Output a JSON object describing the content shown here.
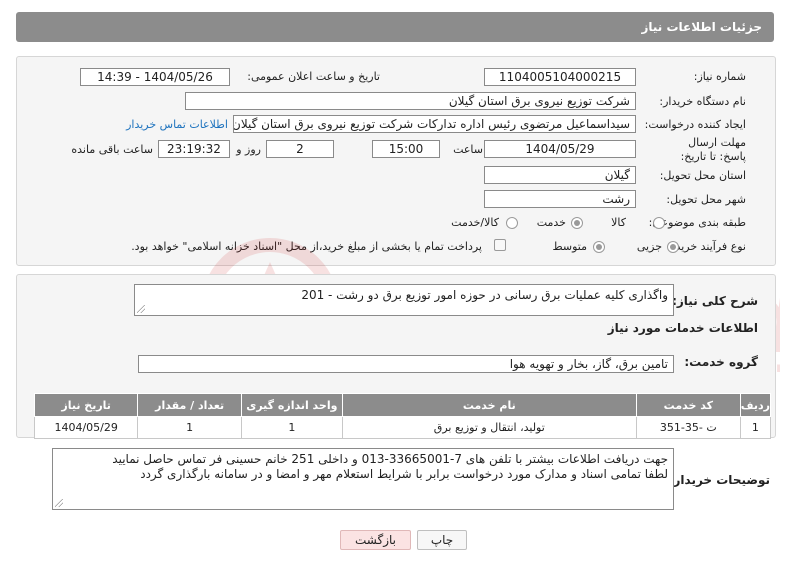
{
  "header": {
    "title": "جزئیات اطلاعات نیاز"
  },
  "form": {
    "need_number": {
      "label": "شماره نیاز:",
      "value": "1104005104000215"
    },
    "announce": {
      "label": "تاریخ و ساعت اعلان عمومی:",
      "value": "1404/05/26 - 14:39"
    },
    "buyer": {
      "label": "نام دستگاه خریدار:",
      "value": "شرکت توزیع نیروی برق استان گیلان"
    },
    "creator": {
      "label": "ایجاد کننده درخواست:",
      "value": "سیداسماعیل مرتضوی رئیس اداره تدارکات شرکت توزیع نیروی برق استان گیلان",
      "contact_link": "اطلاعات تماس خریدار"
    },
    "deadline": {
      "label": "مهلت ارسال پاسخ: تا تاریخ:",
      "date": "1404/05/29",
      "time_label": "ساعت",
      "time": "15:00",
      "days": "2",
      "days_label": "روز و",
      "remaining": "23:19:32",
      "remaining_label": "ساعت باقی مانده"
    },
    "province": {
      "label": "استان محل تحویل:",
      "value": "گیلان"
    },
    "city": {
      "label": "شهر محل تحویل:",
      "value": "رشت"
    },
    "category": {
      "label": "طبقه بندی موضوعی:",
      "options": [
        "کالا",
        "خدمت",
        "کالا/خدمت"
      ],
      "selected": "خدمت"
    },
    "process": {
      "label": "نوع فرآیند خرید :",
      "options": [
        "جزیی",
        "متوسط"
      ],
      "selected": "جزیی",
      "note": "پرداخت تمام یا بخشی از مبلغ خرید،از محل \"اسناد خزانه اسلامی\" خواهد بود."
    }
  },
  "summary": {
    "label": "شرح کلی نیاز:",
    "value": "واگذاری کلیه عملیات برق رسانی در حوزه امور توزیع برق دو رشت - 201"
  },
  "services": {
    "title": "اطلاعات خدمات مورد نیاز",
    "group_label": "گروه خدمت:",
    "group_value": "تامین برق، گاز، بخار و تهویه هوا",
    "columns": [
      "ردیف",
      "کد خدمت",
      "نام خدمت",
      "واحد اندازه گیری",
      "تعداد / مقدار",
      "تاریخ نیاز"
    ],
    "rows": [
      [
        "1",
        "ت -35-351",
        "تولید، انتقال و توزیع برق",
        "1",
        "1",
        "1404/05/29"
      ]
    ]
  },
  "notes": {
    "label": "توضیحات خریدار:",
    "line1": "جهت دریافت اطلاعات بیشتر با تلفن های 7-33665001-013 و داخلی 251 خانم حسینی فر تماس حاصل نمایید",
    "line2": "لطفا تمامی اسناد و مدارک مورد درخواست برابر با شرایط استعلام مهر و امضا و در سامانه بارگذاری گردد"
  },
  "buttons": {
    "print": "چاپ",
    "back": "بازگشت"
  },
  "colors": {
    "header": "#8c8c8c",
    "link": "#1e73be",
    "back_button": "#fbe3e3"
  }
}
